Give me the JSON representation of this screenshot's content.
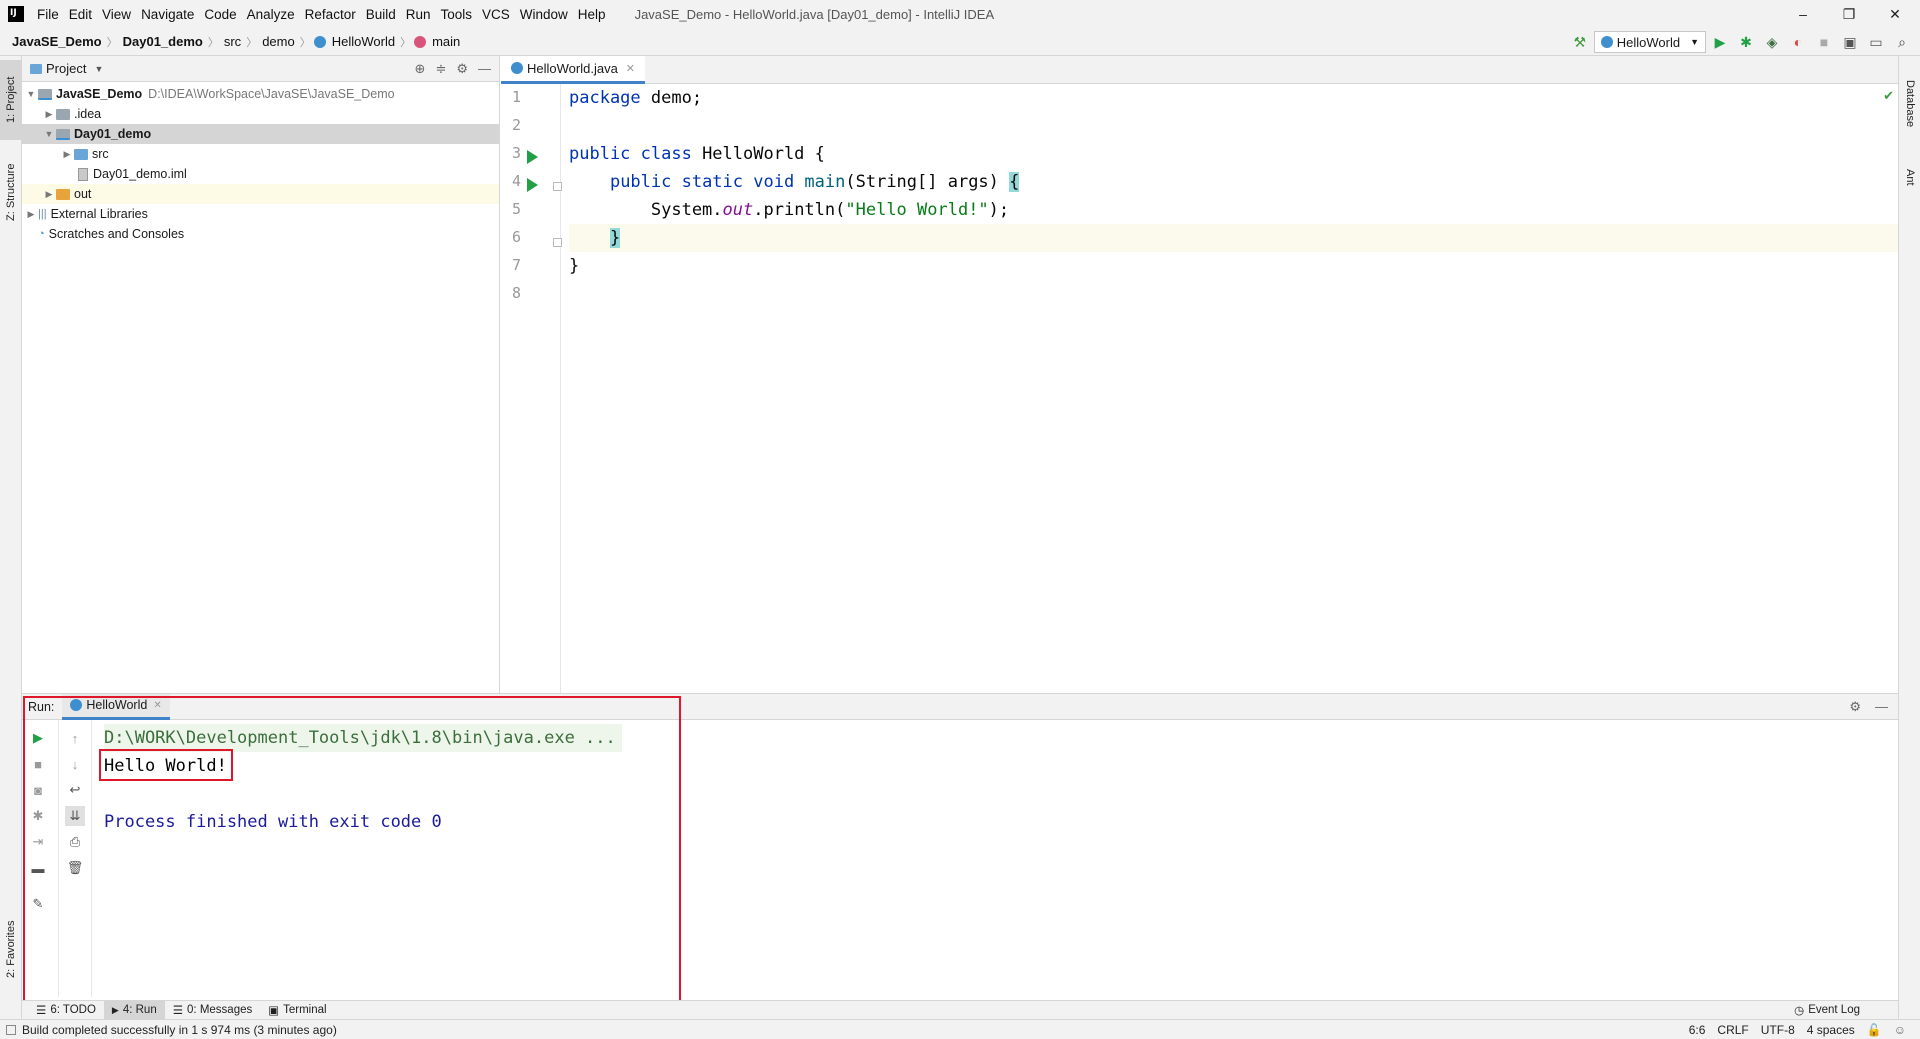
{
  "window": {
    "title": "JavaSE_Demo - HelloWorld.java [Day01_demo] - IntelliJ IDEA",
    "controls": [
      "–",
      "❐",
      "✕"
    ]
  },
  "menu": [
    "File",
    "Edit",
    "View",
    "Navigate",
    "Code",
    "Analyze",
    "Refactor",
    "Build",
    "Run",
    "Tools",
    "VCS",
    "Window",
    "Help"
  ],
  "breadcrumb": [
    "JavaSE_Demo",
    "Day01_demo",
    "src",
    "demo",
    "HelloWorld",
    "main"
  ],
  "run_config": "HelloWorld",
  "left_stripe": {
    "project": "1: Project",
    "structure": "Z: Structure",
    "favorites": "2: Favorites"
  },
  "right_stripe": {
    "database": "Database",
    "ant": "Ant"
  },
  "project_panel": {
    "title": "Project",
    "tree": [
      {
        "label": "JavaSE_Demo",
        "path": "D:\\IDEA\\WorkSpace\\JavaSE\\JavaSE_Demo"
      },
      {
        "label": ".idea"
      },
      {
        "label": "Day01_demo"
      },
      {
        "label": "src"
      },
      {
        "label": "Day01_demo.iml"
      },
      {
        "label": "out"
      },
      {
        "label": "External Libraries"
      },
      {
        "label": "Scratches and Consoles"
      }
    ]
  },
  "editor": {
    "tab": "HelloWorld.java",
    "line_numbers": [
      "1",
      "2",
      "3",
      "4",
      "5",
      "6",
      "7",
      "8"
    ],
    "code": {
      "l1_kw": "package",
      "l1_rest": " demo;",
      "l3_kw": "public class",
      "l3_rest": " HelloWorld {",
      "l4_indent": "    ",
      "l4_kw": "public static void",
      "l4_name": " main",
      "l4_rest": "(String[] args) ",
      "l4_brace": "{",
      "l5_a": "        System.",
      "l5_field": "out",
      "l5_b": ".println(",
      "l5_str": "\"Hello World!\"",
      "l5_c": ");",
      "l6_indent": "    ",
      "l6_brace": "}",
      "l7": "}"
    }
  },
  "run_panel": {
    "label": "Run:",
    "tab": "HelloWorld",
    "console": {
      "command": "D:\\WORK\\Development_Tools\\jdk\\1.8\\bin\\java.exe ...",
      "output": "Hello World!",
      "exit": "Process finished with exit code 0"
    }
  },
  "bottom_tabs": [
    "6: TODO",
    "4: Run",
    "0: Messages",
    "Terminal"
  ],
  "event_log": "Event Log",
  "status": {
    "message": "Build completed successfully in 1 s 974 ms (3 minutes ago)",
    "position": "6:6",
    "line_sep": "CRLF",
    "encoding": "UTF-8",
    "indent": "4 spaces"
  },
  "colors": {
    "accent": "#4083c9",
    "run_green": "#22a045",
    "highlight_red": "#e0162b",
    "keyword": "#0033b3",
    "string": "#067d17"
  }
}
